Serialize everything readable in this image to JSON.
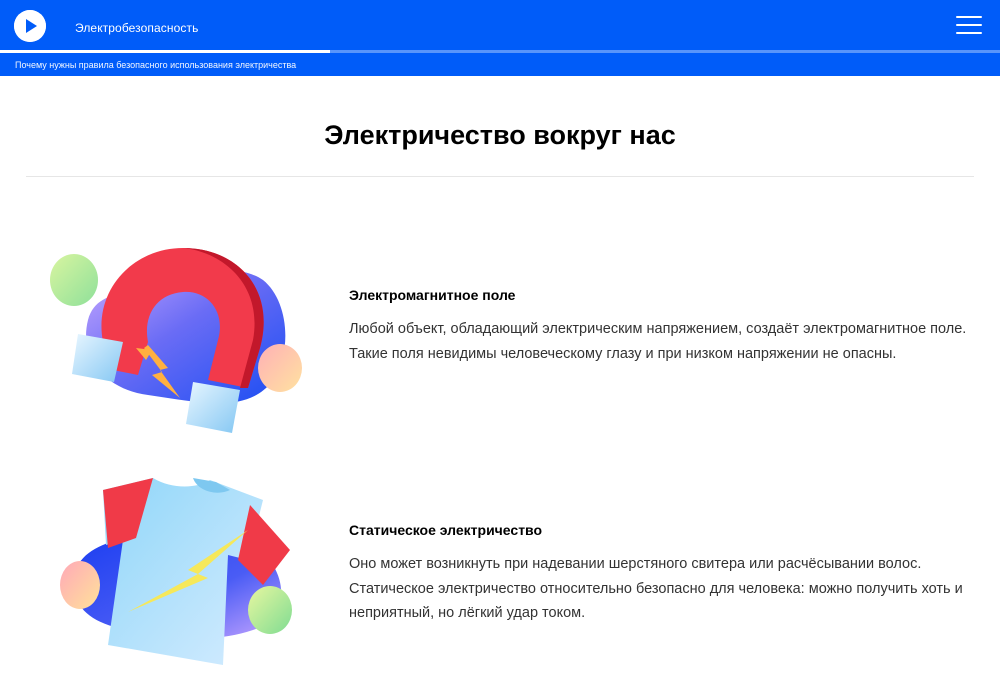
{
  "header": {
    "app_title": "Электробезопасность",
    "subtitle": "Почему нужны правила безопасного использования электричества",
    "progress": 0.33,
    "logo_icon": "play-icon",
    "menu_icon": "hamburger-menu-icon",
    "background_color": "#005cf9"
  },
  "main": {
    "title": "Электричество вокруг нас",
    "sections": [
      {
        "heading": "Электромагнитное поле",
        "text": "Любой объект, обладающий электрическим напряжением, создаёт электромагнитное поле. Такие поля невидимы человеческому глазу и при низком напряжении не опасны.",
        "illustration": "magnet-icon"
      },
      {
        "heading": "Статическое электричество",
        "text": "Оно может возникнуть при надевании шерстяного свитера или расчёсывании волос. Статическое электричество относительно безопасно для человека: можно получить хоть и неприятный, но лёгкий удар током.",
        "illustration": "tshirt-lightning-icon"
      }
    ]
  }
}
